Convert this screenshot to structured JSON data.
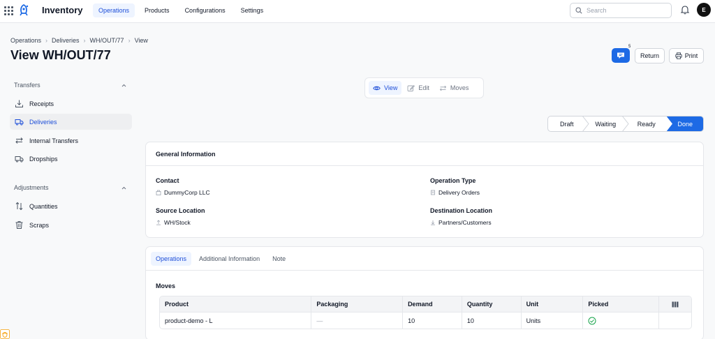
{
  "app": {
    "title": "Inventory",
    "accent": "#1d6ae5",
    "icons": {
      "apps": "apps-grid-icon",
      "logo": "rocket-icon",
      "bell": "bell-icon"
    }
  },
  "nav": {
    "items": [
      {
        "label": "Operations",
        "active": true
      },
      {
        "label": "Products",
        "active": false
      },
      {
        "label": "Configurations",
        "active": false
      },
      {
        "label": "Settings",
        "active": false
      }
    ]
  },
  "search": {
    "placeholder": "Search"
  },
  "user": {
    "initial": "E"
  },
  "breadcrumb": [
    "Operations",
    "Deliveries",
    "WH/OUT/77",
    "View"
  ],
  "page": {
    "title": "View WH/OUT/77"
  },
  "actions": {
    "feedback_count": "5",
    "return_label": "Return",
    "print_label": "Print"
  },
  "sidebar": {
    "sections": [
      {
        "label": "Transfers",
        "items": [
          {
            "label": "Receipts",
            "icon": "receipt-download-icon",
            "active": false
          },
          {
            "label": "Deliveries",
            "icon": "truck-icon",
            "active": true
          },
          {
            "label": "Internal Transfers",
            "icon": "transfer-arrows-icon",
            "active": false
          },
          {
            "label": "Dropships",
            "icon": "dropship-truck-icon",
            "active": false
          }
        ]
      },
      {
        "label": "Adjustments",
        "items": [
          {
            "label": "Quantities",
            "icon": "sort-arrows-icon",
            "active": false
          },
          {
            "label": "Scraps",
            "icon": "trash-icon",
            "active": false
          }
        ]
      }
    ]
  },
  "view_switcher": [
    {
      "label": "View",
      "icon": "eye-icon",
      "active": true
    },
    {
      "label": "Edit",
      "icon": "pencil-icon",
      "active": false
    },
    {
      "label": "Moves",
      "icon": "arrows-icon",
      "active": false
    }
  ],
  "status": {
    "steps": [
      "Draft",
      "Waiting",
      "Ready",
      "Done"
    ],
    "current": "Done"
  },
  "general": {
    "title": "General Information",
    "contact_label": "Contact",
    "contact_value": "DummyCorp LLC",
    "operation_type_label": "Operation Type",
    "operation_type_value": "Delivery Orders",
    "source_label": "Source Location",
    "source_value": "WH/Stock",
    "destination_label": "Destination Location",
    "destination_value": "Partners/Customers"
  },
  "tabs": [
    {
      "label": "Operations",
      "active": true
    },
    {
      "label": "Additional Information",
      "active": false
    },
    {
      "label": "Note",
      "active": false
    }
  ],
  "moves": {
    "title": "Moves",
    "columns": [
      "Product",
      "Packaging",
      "Demand",
      "Quantity",
      "Unit",
      "Picked"
    ],
    "rows": [
      {
        "product": "product-demo - L",
        "packaging": "—",
        "demand": "10",
        "quantity": "10",
        "unit": "Units",
        "picked": true
      }
    ]
  }
}
